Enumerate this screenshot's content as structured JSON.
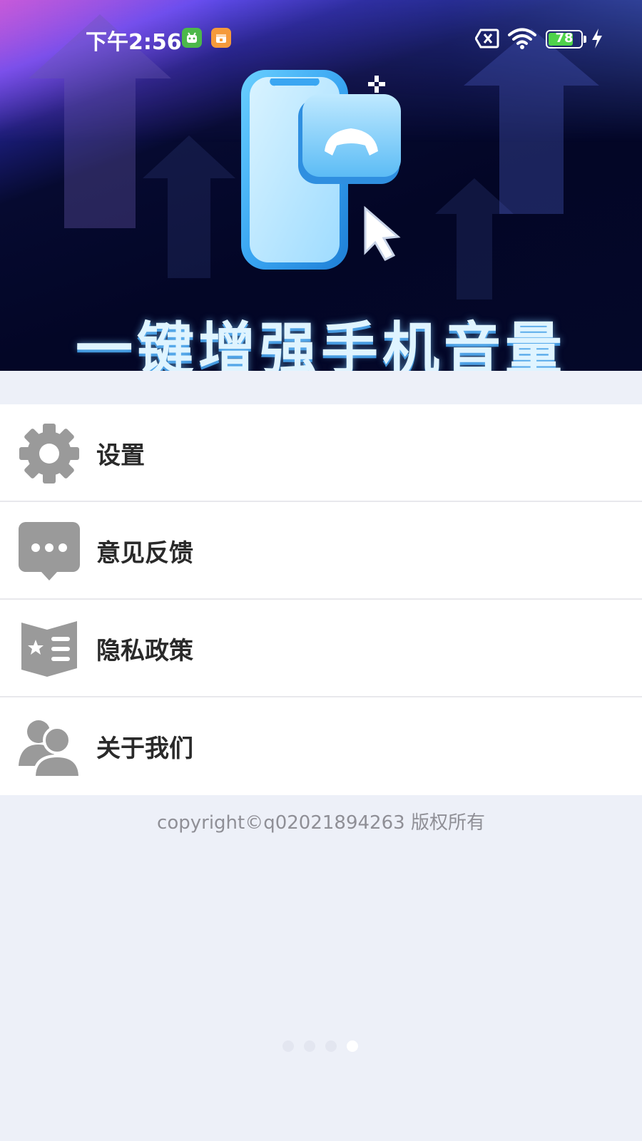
{
  "status_bar": {
    "time": "下午2:56",
    "battery_level": "78",
    "battery_fraction": 0.78,
    "icons": [
      "android-app-icon",
      "calendar-app-icon",
      "sim-error-icon",
      "wifi-icon",
      "battery-icon",
      "charging-icon"
    ]
  },
  "banner": {
    "title": "一键增强手机音量",
    "illustration": "phone-call-cursor-illustration"
  },
  "menu": {
    "items": [
      {
        "label": "设置",
        "icon": "gear-icon"
      },
      {
        "label": "意见反馈",
        "icon": "chat-bubble-icon"
      },
      {
        "label": "隐私政策",
        "icon": "policy-book-icon"
      },
      {
        "label": "关于我们",
        "icon": "users-icon"
      }
    ]
  },
  "footer": {
    "copyright": "copyright©q02021894263 版权所有"
  },
  "pager": {
    "count": 4,
    "active_index": 3
  },
  "colors": {
    "page_background": "#edf0f8",
    "icon_gray": "#9a9a9a",
    "label_text": "#2a2a2a",
    "banner_dark": "#040829",
    "title_light_blue": "#dff4ff"
  }
}
